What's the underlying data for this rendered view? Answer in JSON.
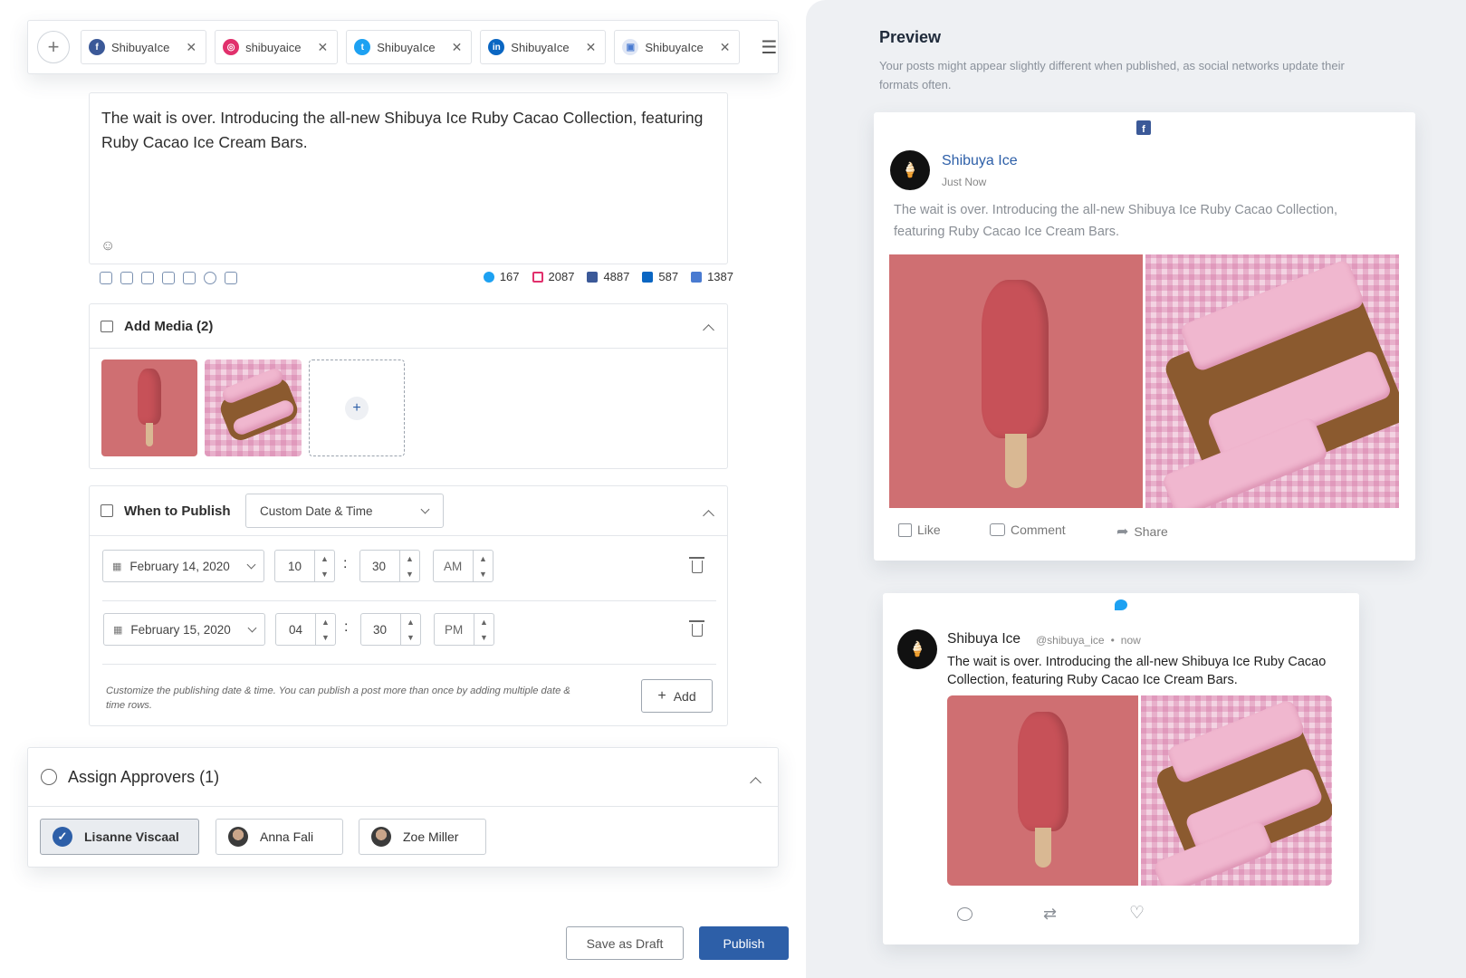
{
  "accounts": [
    {
      "network": "facebook",
      "name": "ShibuyaIce",
      "color": "#3b5998"
    },
    {
      "network": "instagram",
      "name": "shibuyaice",
      "color": "#e1306c"
    },
    {
      "network": "twitter",
      "name": "ShibuyaIce",
      "color": "#1da1f2"
    },
    {
      "network": "linkedin",
      "name": "ShibuyaIce",
      "color": "#0a66c2"
    },
    {
      "network": "gmb",
      "name": "ShibuyaIce",
      "color": "#4a7bd1"
    }
  ],
  "composer": {
    "text": "The wait is over. Introducing the all-new Shibuya Ice Ruby Cacao Collection, featuring Ruby Cacao Ice Cream Bars.",
    "counts": {
      "twitter": "167",
      "instagram": "2087",
      "facebook": "4887",
      "linkedin": "587",
      "gmb": "1387"
    }
  },
  "media": {
    "title": "Add Media (2)",
    "add": "+"
  },
  "publish": {
    "title": "When to Publish",
    "mode": "Custom Date & Time",
    "rows": [
      {
        "date": "February 14, 2020",
        "hour": "10",
        "minute": "30",
        "ampm": "AM"
      },
      {
        "date": "February 15, 2020",
        "hour": "04",
        "minute": "30",
        "ampm": "PM"
      }
    ],
    "hint": "Customize the publishing date & time. You can publish a post more than once by adding multiple date & time rows.",
    "add_label": "Add",
    "colon": ":"
  },
  "approvers": {
    "title": "Assign Approvers (1)",
    "people": [
      {
        "name": "Lisanne Viscaal",
        "selected": true
      },
      {
        "name": "Anna Fali",
        "selected": false
      },
      {
        "name": "Zoe Miller",
        "selected": false
      }
    ]
  },
  "actions": {
    "draft": "Save as Draft",
    "publish": "Publish"
  },
  "preview": {
    "title": "Preview",
    "subtitle": "Your posts might appear slightly different when published, as social networks update their formats often.",
    "fb": {
      "name": "Shibuya Ice",
      "time": "Just Now",
      "text": "The wait is over. Introducing the all-new Shibuya Ice Ruby Cacao Collection, featuring Ruby Cacao Ice Cream Bars.",
      "like": "Like",
      "comment": "Comment",
      "share": "Share"
    },
    "tw": {
      "name": "Shibuya Ice",
      "handle": "@shibuya_ice",
      "dot": "•",
      "time": "now",
      "text": "The wait is over. Introducing the all-new Shibuya Ice Ruby Cacao Collection, featuring Ruby Cacao Ice Cream Bars."
    }
  }
}
